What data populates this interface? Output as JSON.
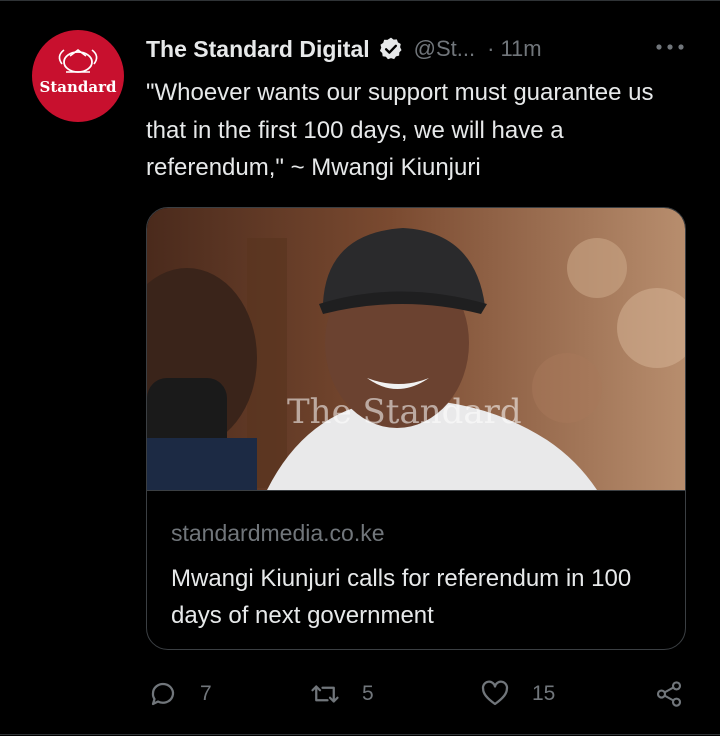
{
  "tweet": {
    "avatar_text": "Standard",
    "display_name": "The Standard Digital",
    "handle": "@St...",
    "time_separator": "·",
    "time": "11m",
    "text": "\"Whoever wants our support must guarantee us that in the first 100 days, we will have a referendum,\" ~ Mwangi Kiunjuri"
  },
  "card": {
    "watermark": "The Standard",
    "domain": "standardmedia.co.ke",
    "title": "Mwangi Kiunjuri calls for referendum in 100 days of next government"
  },
  "actions": {
    "replies": "7",
    "retweets": "5",
    "likes": "15"
  },
  "icons": {
    "verified": "verified-badge-icon",
    "more": "more-dots-icon",
    "reply": "reply-bubble-icon",
    "retweet": "retweet-icon",
    "like": "heart-icon",
    "share": "share-icon"
  },
  "colors": {
    "background": "#000000",
    "text_primary": "#e7e9ea",
    "text_secondary": "#71767b",
    "brand_red": "#c8102e",
    "border": "#3b3f43"
  }
}
